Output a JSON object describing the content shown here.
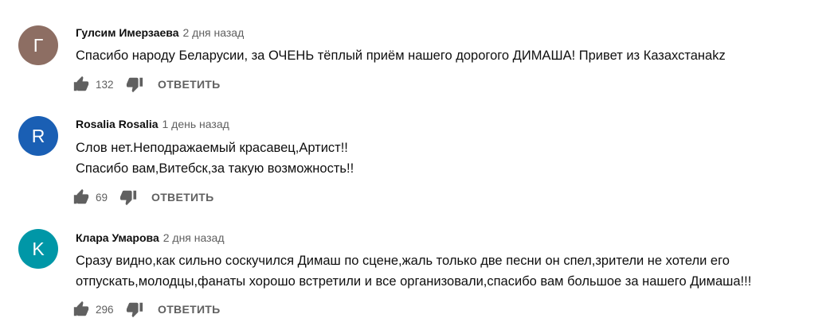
{
  "comments": [
    {
      "avatar_letter": "Г",
      "avatar_color": "#8d6e63",
      "author": "Гулсим Имерзаева",
      "time": "2 дня назад",
      "lines": [
        "Спасибо народу Беларусии,  за ОЧЕНЬ тёплый приём нашего дорогого ДИМАША!  Привет из Казахстанаkz"
      ],
      "likes": "132",
      "reply_label": "ОТВЕТИТЬ"
    },
    {
      "avatar_letter": "R",
      "avatar_color": "#1a5fb4",
      "author": "Rosalia Rosalia",
      "time": "1 день назад",
      "lines": [
        "Слов нет.Неподражаемый красавец,Артист!!",
        "Спасибо вам,Витебск,за такую возможность!!"
      ],
      "likes": "69",
      "reply_label": "ОТВЕТИТЬ"
    },
    {
      "avatar_letter": "K",
      "avatar_color": "#0097a7",
      "author": "Клара Умарова",
      "time": "2 дня назад",
      "lines": [
        "Сразу видно,как сильно соскучился Димаш по сцене,жаль только две песни он спел,зрители не хотели его",
        "отпускать,молодцы,фанаты хорошо встретили и все организовали,спасибо вам большое за нашего Димаша!!!"
      ],
      "likes": "296",
      "reply_label": "ОТВЕТИТЬ"
    }
  ]
}
